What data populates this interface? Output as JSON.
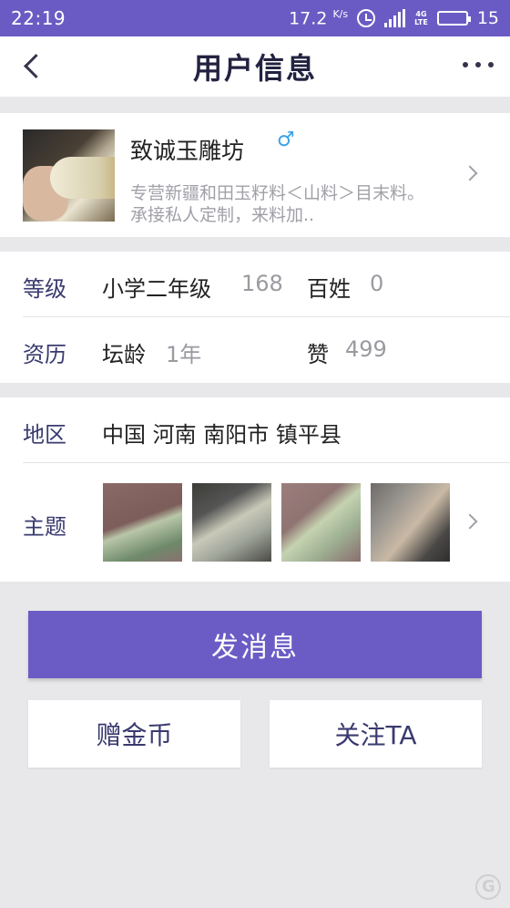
{
  "status_bar": {
    "time": "22:19",
    "speed_value": "17.2",
    "speed_unit": "K/s",
    "network_type": "4G",
    "network_sub": "LTE",
    "battery": "15"
  },
  "nav": {
    "title": "用户信息"
  },
  "profile": {
    "name": "致诚玉雕坊",
    "gender_symbol": "♂",
    "description": "专营新疆和田玉籽料＜山料＞目末料。承接私人定制，来料加..",
    "avatar_icon": "avatar"
  },
  "info": {
    "level_label": "等级",
    "level_value": "小学二年级",
    "level_points": "168",
    "baixing_label": "百姓",
    "baixing_value": "0",
    "record_label": "资历",
    "forum_age_label": "坛龄",
    "forum_age_value": "1年",
    "likes_label": "赞",
    "likes_value": "499"
  },
  "location": {
    "label": "地区",
    "value": "中国 河南 南阳市 镇平县"
  },
  "topics": {
    "label": "主题",
    "thumbnails": [
      "topic-thumb-1",
      "topic-thumb-2",
      "topic-thumb-3",
      "topic-thumb-4"
    ]
  },
  "actions": {
    "send_message": "发消息",
    "gift_coins": "赠金币",
    "follow": "关注TA"
  },
  "colors": {
    "accent": "#6b5cc5",
    "status_bar": "#6a5bc4",
    "label_text": "#3a3a70",
    "gender_icon": "#3aa2e6"
  }
}
